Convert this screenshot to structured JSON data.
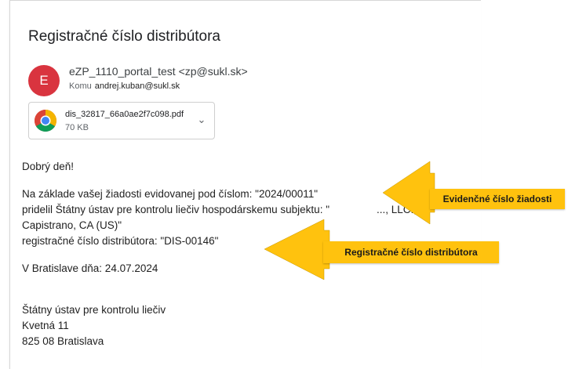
{
  "email": {
    "subject": "Registračné číslo distribútora",
    "sender_initial": "E",
    "from": "eZP_1110_portal_test <zp@sukl.sk>",
    "to_label": "Komu",
    "to_address": "andrej.kuban@sukl.sk",
    "attachment": {
      "filename": "dis_32817_66a0ae2f7c098.pdf",
      "size": "70 KB"
    },
    "body": {
      "greeting": "Dobrý deň!",
      "line1": "Na základe vašej žiadosti evidovanej pod číslom: \"2024/00011\"",
      "line2": "pridelil Štátny ústav pre kontrolu liečiv hospodárskemu subjektu: \"",
      "line2_tail": "..., LLC., ,",
      "line3": "Capistrano, CA (US)\"",
      "line4": "registračné číslo distribútora: \"DIS-00146\"",
      "date_line": "V Bratislave dňa: 24.07.2024",
      "sig1": "Štátny ústav pre kontrolu liečiv",
      "sig2": "Kvetná 11",
      "sig3": "825 08 Bratislava"
    }
  },
  "callouts": {
    "evidencne": "Evidenčné číslo žiadosti",
    "registracne": "Registračné číslo distribútora"
  },
  "colors": {
    "callout": "#ffc20e",
    "avatar": "#d9343f"
  }
}
